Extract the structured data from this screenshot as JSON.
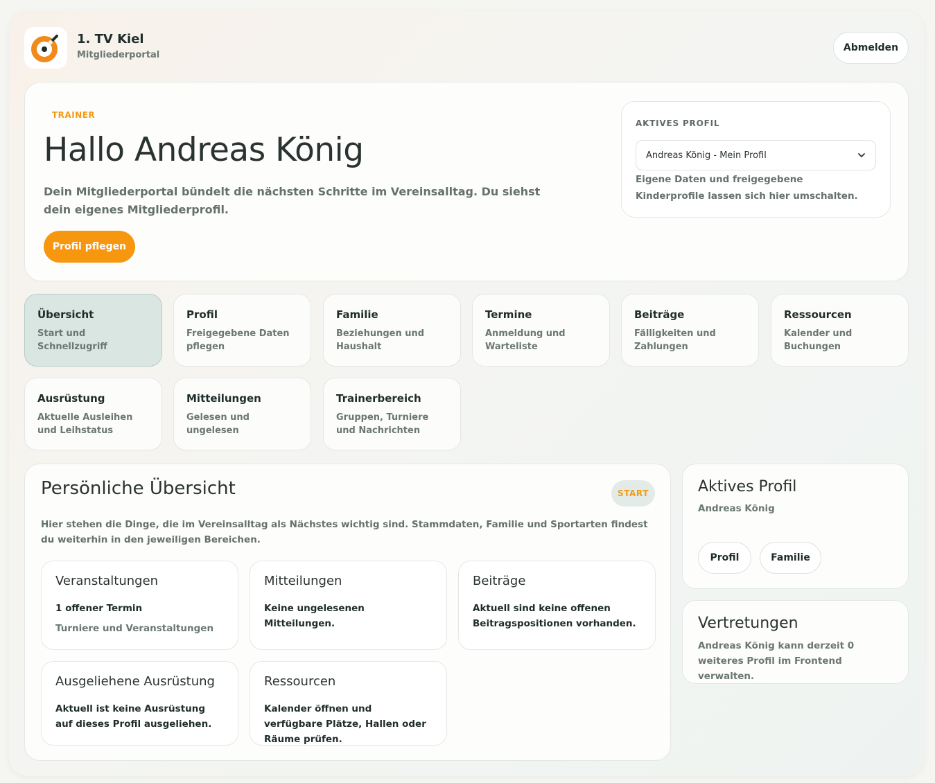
{
  "header": {
    "club_name": "1. TV Kiel",
    "portal_name": "Mitgliederportal",
    "logout_label": "Abmelden",
    "logo_icon": "club-logo-icon"
  },
  "hero": {
    "role_tag": "TRAINER",
    "greeting": "Hallo Andreas König",
    "intro": "Dein Mitgliederportal bündelt die nächsten Schritte im Vereinsalltag. Du siehst dein eigenes Mitgliederprofil.",
    "primary_button": "Profil pflegen",
    "active_profile": {
      "label": "AKTIVES PROFIL",
      "selected": "Andreas König - Mein Profil",
      "hint": "Eigene Daten und freigegebene Kinderprofile lassen sich hier umschalten."
    }
  },
  "nav": [
    {
      "title": "Übersicht",
      "subtitle": "Start und Schnellzugriff",
      "active": true
    },
    {
      "title": "Profil",
      "subtitle": "Freigegebene Daten pflegen"
    },
    {
      "title": "Familie",
      "subtitle": "Beziehungen und Haushalt"
    },
    {
      "title": "Termine",
      "subtitle": "Anmeldung und Warteliste"
    },
    {
      "title": "Beiträge",
      "subtitle": "Fälligkeiten und Zahlungen"
    },
    {
      "title": "Ressourcen",
      "subtitle": "Kalender und Buchungen"
    },
    {
      "title": "Ausrüstung",
      "subtitle": "Aktuelle Ausleihen und Leihstatus"
    },
    {
      "title": "Mitteilungen",
      "subtitle": "Gelesen und ungelesen"
    },
    {
      "title": "Trainerbereich",
      "subtitle": "Gruppen, Turniere und Nachrichten"
    }
  ],
  "overview": {
    "title": "Persönliche Übersicht",
    "badge": "START",
    "intro": "Hier stehen die Dinge, die im Vereinsalltag als Nächstes wichtig sind. Stammdaten, Familie und Sportarten findest du weiterhin in den jeweiligen Bereichen.",
    "cards": [
      {
        "title": "Veranstaltungen",
        "text": "1 offener Termin",
        "sub": "Turniere und Veranstaltungen"
      },
      {
        "title": "Mitteilungen",
        "text": "Keine ungelesenen Mitteilungen."
      },
      {
        "title": "Beiträge",
        "text": "Aktuell sind keine offenen Beitragspositionen vorhanden."
      },
      {
        "title": "Ausgeliehene Ausrüstung",
        "text": "Aktuell ist keine Ausrüstung auf dieses Profil ausgeliehen."
      },
      {
        "title": "Ressourcen",
        "text": "Kalender öffnen und verfügbare Plätze, Hallen oder Räume prüfen."
      }
    ]
  },
  "sidebar": {
    "active_profile": {
      "title": "Aktives Profil",
      "name": "Andreas König",
      "buttons": [
        "Profil",
        "Familie"
      ]
    },
    "representations": {
      "title": "Vertretungen",
      "text": "Andreas König kann derzeit 0 weiteres Profil im Frontend verwalten."
    }
  },
  "colors": {
    "accent": "#f7960f",
    "active_tile": "#d9e6e2",
    "text_dark": "#1f2d2a",
    "text_muted": "#6a7773"
  }
}
